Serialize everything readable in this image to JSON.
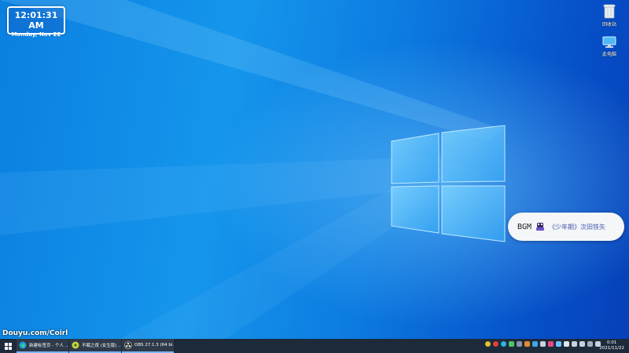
{
  "clock_widget": {
    "time": "12:01:31 AM",
    "date": "Monday, Nov 22"
  },
  "desktop_icons": [
    {
      "label": "回收站",
      "icon": "recycle-bin-icon"
    },
    {
      "label": "此电脑",
      "icon": "this-pc-icon"
    }
  ],
  "bgm_popup": {
    "label": "BGM",
    "song": "《少年期》次田铁矢"
  },
  "watermark": "Douyu.com/Coirl",
  "taskbar": {
    "items": [
      {
        "label": "新建标签页 - 个人 ...",
        "icon": "edge-browser-icon"
      },
      {
        "label": "不眠之夜 (女生版) ...",
        "icon": "music-player-icon"
      },
      {
        "label": "OBS 27.1.3 (64 bi...",
        "icon": "obs-icon"
      }
    ],
    "clock_time": "0:01",
    "clock_date": "2021/11/22"
  },
  "colors": {
    "taskbar": "#1d2a3a",
    "accent": "#7fb6ff"
  }
}
